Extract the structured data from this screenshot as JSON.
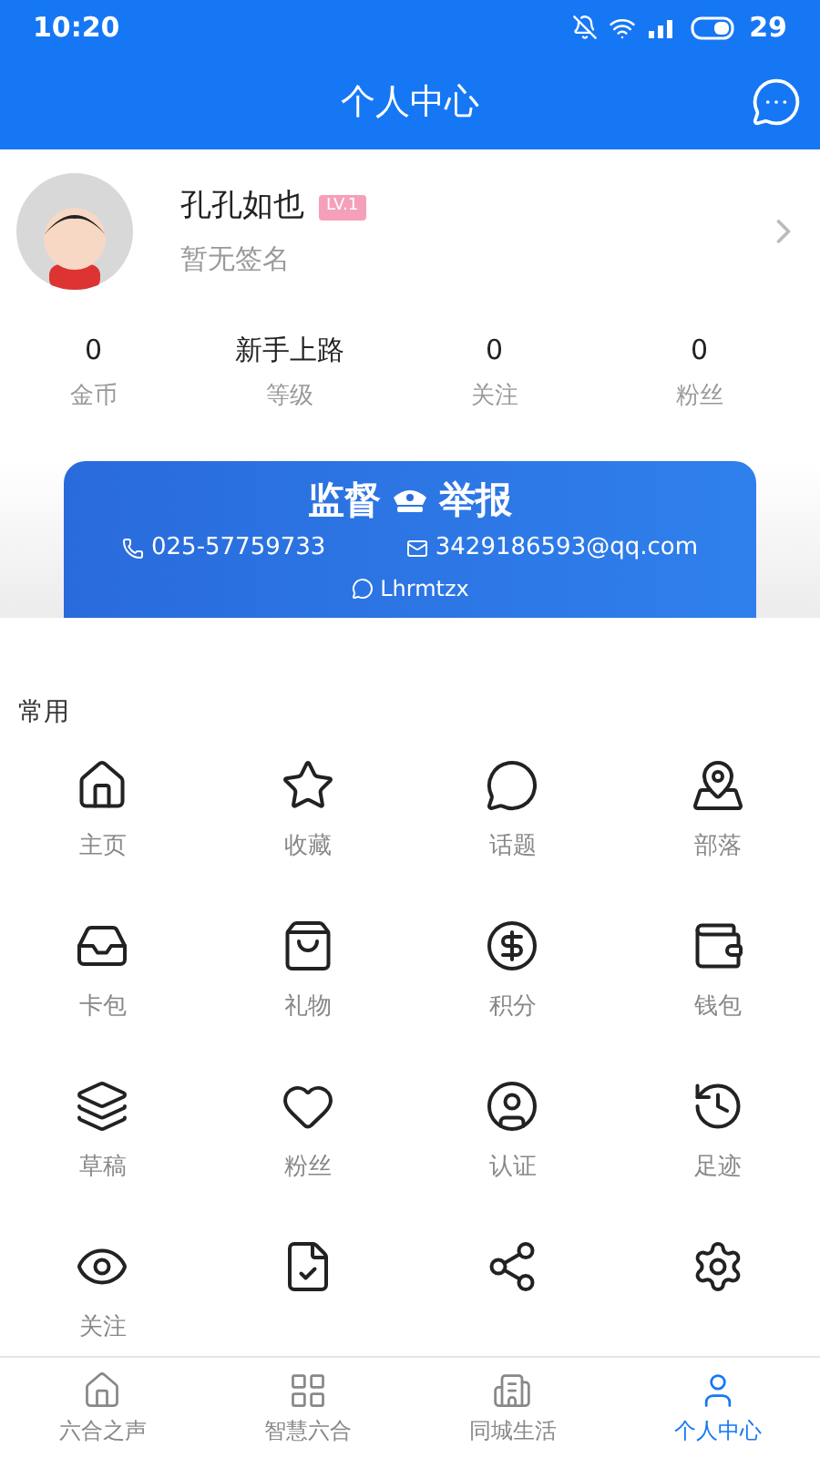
{
  "status_bar": {
    "time": "10:20",
    "battery": "29"
  },
  "header": {
    "title": "个人中心"
  },
  "profile": {
    "name": "孔孔如也",
    "badge": "LV.1",
    "signature": "暂无签名"
  },
  "stats": [
    {
      "value": "0",
      "label": "金币"
    },
    {
      "value": "新手上路",
      "label": "等级"
    },
    {
      "value": "0",
      "label": "关注"
    },
    {
      "value": "0",
      "label": "粉丝"
    }
  ],
  "report_banner": {
    "title_left": "监督",
    "title_right": "举报",
    "phone": "025-57759733",
    "email": "3429186593@qq.com",
    "wechat": "Lhrmtzx"
  },
  "section": {
    "title": "常用"
  },
  "grid": [
    {
      "kind": "labeled",
      "label": "主页"
    },
    {
      "kind": "labeled",
      "label": "收藏"
    },
    {
      "kind": "labeled",
      "label": "话题"
    },
    {
      "kind": "labeled",
      "label": "部落"
    },
    {
      "kind": "labeled",
      "label": "卡包"
    },
    {
      "kind": "labeled",
      "label": "礼物"
    },
    {
      "kind": "labeled",
      "label": "积分"
    },
    {
      "kind": "labeled",
      "label": "钱包"
    },
    {
      "kind": "labeled",
      "label": "草稿"
    },
    {
      "kind": "labeled",
      "label": "粉丝"
    },
    {
      "kind": "labeled",
      "label": "认证"
    },
    {
      "kind": "labeled",
      "label": "足迹"
    },
    {
      "kind": "labeled",
      "label": "关注"
    },
    {
      "kind": "icon"
    },
    {
      "kind": "icon"
    },
    {
      "kind": "icon"
    }
  ],
  "bottom_nav": [
    {
      "label": "六合之声",
      "selected": false
    },
    {
      "label": "智慧六合",
      "selected": false
    },
    {
      "label": "同城生活",
      "selected": false
    },
    {
      "label": "个人中心",
      "selected": true
    }
  ]
}
